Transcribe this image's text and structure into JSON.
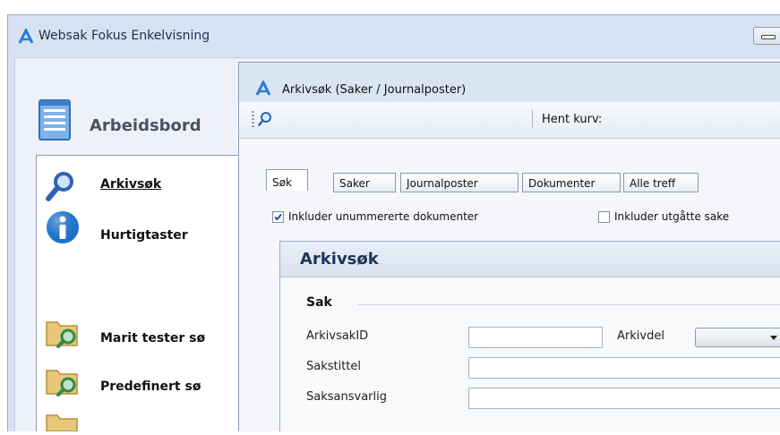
{
  "app": {
    "title": "Websak Fokus Enkelvisning"
  },
  "dashboard": {
    "title": "Arbeidsbord"
  },
  "side_nav": {
    "items": [
      {
        "label": "Arkivsøk",
        "icon": "search-icon"
      },
      {
        "label": "Hurtigtaster",
        "icon": "info-icon"
      },
      {
        "label": "Marit tester sø",
        "icon": "folder-search-icon"
      },
      {
        "label": "Predefinert sø",
        "icon": "folder-search-icon"
      }
    ]
  },
  "dialog": {
    "title": "Arkivsøk (Saker / Journalposter)",
    "toolbar": {
      "fetch_basket": "Hent kurv:"
    },
    "tabs": [
      "Søk",
      "Saker",
      "Journalposter",
      "Dokumenter",
      "Alle treff"
    ],
    "active_tab": "Søk",
    "options": [
      {
        "label": "Inkluder unummererte dokumenter",
        "checked": true
      },
      {
        "label": "Inkluder utgåtte sake",
        "checked": false
      }
    ],
    "section": {
      "title": "Arkivsøk",
      "group": "Sak",
      "fields": {
        "arkivsak_id": {
          "label": "ArkivsakID",
          "value": ""
        },
        "arkivdel": {
          "label": "Arkivdel",
          "value": ""
        },
        "sakstittel": {
          "label": "Sakstittel",
          "value": ""
        },
        "saksansvarlig": {
          "label": "Saksansvarlig",
          "value": ""
        }
      }
    }
  },
  "colors": {
    "accent": "#1f5fa8",
    "title_bar": "#d6e2f2",
    "section_title": "#1d3557"
  }
}
